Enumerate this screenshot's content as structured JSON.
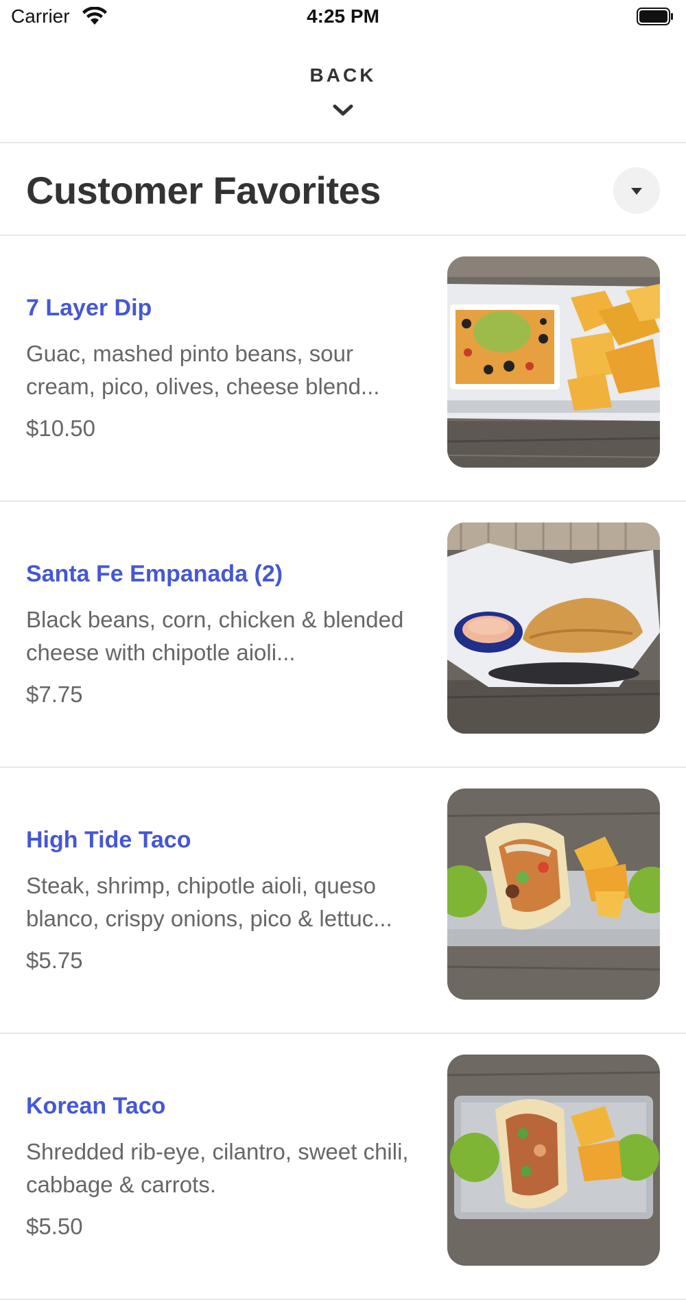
{
  "status_bar": {
    "carrier": "Carrier",
    "time": "4:25 PM"
  },
  "header": {
    "back_label": "BACK"
  },
  "section": {
    "title": "Customer Favorites"
  },
  "items": [
    {
      "name": "7 Layer Dip",
      "description": "Guac, mashed pinto beans, sour cream, pico, olives, cheese blend...",
      "price": "$10.50",
      "photo": "seven-layer-dip-photo"
    },
    {
      "name": "Santa Fe Empanada (2)",
      "description": "Black beans, corn, chicken & blended cheese with chipotle aioli...",
      "price": "$7.75",
      "photo": "empanada-photo"
    },
    {
      "name": "High Tide Taco",
      "description": "Steak, shrimp, chipotle aioli, queso blanco, crispy onions, pico & lettuc...",
      "price": "$5.75",
      "photo": "high-tide-taco-photo"
    },
    {
      "name": "Korean Taco",
      "description": "Shredded rib-eye, cilantro, sweet chili, cabbage & carrots.",
      "price": "$5.50",
      "photo": "korean-taco-photo"
    }
  ],
  "icons": {
    "wifi": "wifi-icon",
    "battery": "battery-icon",
    "back_chevron": "chevron-down-icon",
    "dropdown": "caret-down-icon"
  },
  "colors": {
    "accent": "#4557d6",
    "text": "#333333",
    "muted": "#666666",
    "divider": "#e6e6e6"
  }
}
